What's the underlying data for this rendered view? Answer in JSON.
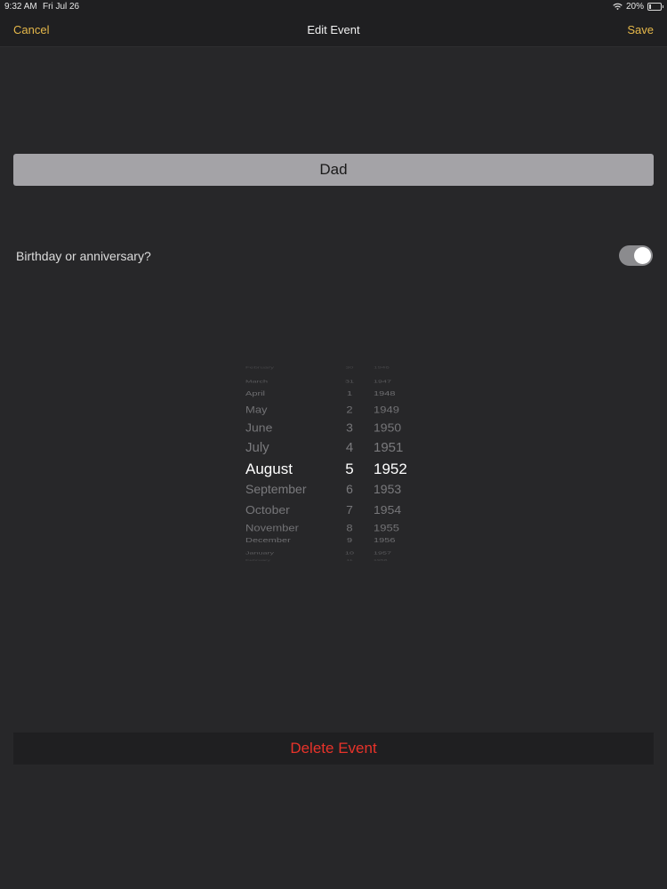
{
  "status": {
    "time": "9:32 AM",
    "date": "Fri Jul 26",
    "battery": "20%",
    "battery_level": 0.2
  },
  "nav": {
    "cancel_label": "Cancel",
    "title": "Edit Event",
    "save_label": "Save"
  },
  "name_field": {
    "value": "Dad"
  },
  "toggle_row": {
    "label": "Birthday or anniversary?",
    "on": true
  },
  "picker": {
    "months": [
      "February",
      "March",
      "April",
      "May",
      "June",
      "July",
      "August",
      "September",
      "October",
      "November",
      "December",
      "January",
      "February"
    ],
    "days": [
      "30",
      "31",
      "1",
      "2",
      "3",
      "4",
      "5",
      "6",
      "7",
      "8",
      "9",
      "10",
      "11"
    ],
    "years": [
      "1946",
      "1947",
      "1948",
      "1949",
      "1950",
      "1951",
      "1952",
      "1953",
      "1954",
      "1955",
      "1956",
      "1957",
      "1958"
    ],
    "selected": {
      "month": "August",
      "day": "5",
      "year": "1952"
    }
  },
  "delete_label": "Delete Event",
  "colors": {
    "accent": "#e6b84a",
    "destructive": "#e8332a",
    "background": "#272729"
  }
}
